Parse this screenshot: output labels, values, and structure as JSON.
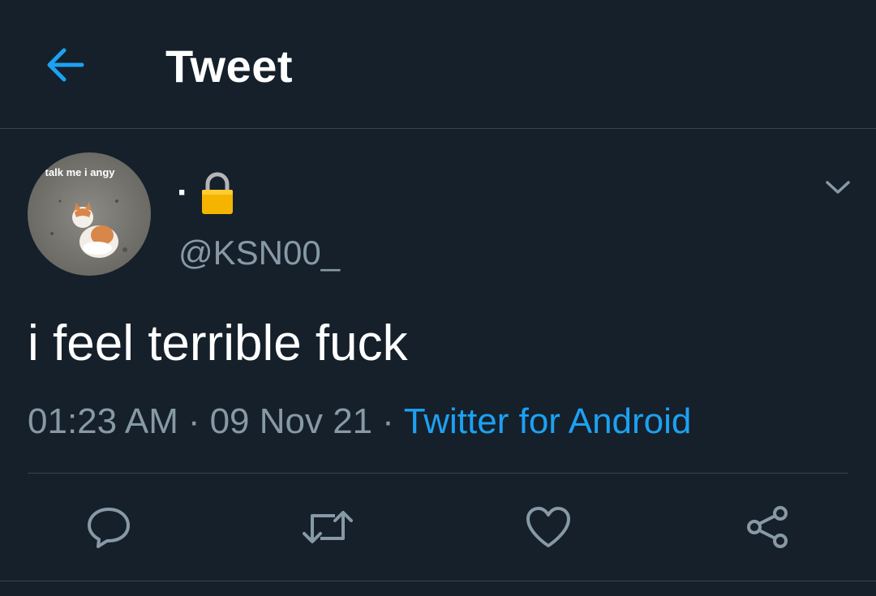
{
  "header": {
    "title": "Tweet",
    "back_icon": "arrow-left-icon"
  },
  "author": {
    "display_name": "·",
    "lock_icon": "lock-emoji",
    "handle": "@KSN00_",
    "avatar_caption": "o talk me i angy"
  },
  "tweet": {
    "text": "i feel terrible fuck",
    "time": "01:23 AM",
    "date": "09 Nov 21",
    "separator": "·",
    "source": "Twitter for Android"
  },
  "actions": [
    {
      "name": "reply",
      "icon": "comment-icon"
    },
    {
      "name": "retweet",
      "icon": "retweet-icon"
    },
    {
      "name": "like",
      "icon": "heart-icon"
    },
    {
      "name": "share",
      "icon": "share-icon"
    }
  ],
  "colors": {
    "background": "#15202b",
    "accent": "#1da1f2",
    "secondary_text": "#8899a6",
    "border": "#38444d"
  }
}
